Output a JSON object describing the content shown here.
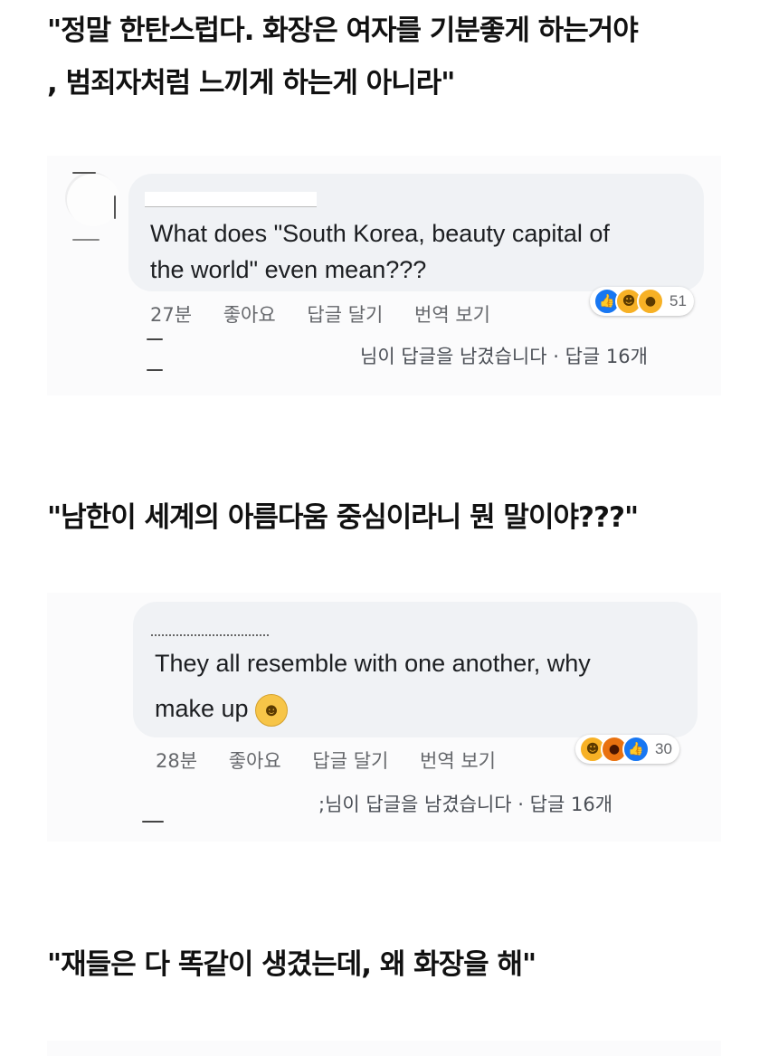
{
  "captions": {
    "c1_line1": "\"정말 한탄스럽다. 화장은 여자를 기분좋게 하는거야",
    "c1_line2": ", 범죄자처럼 느끼게 하는게 아니라\"",
    "c2": "\"남한이 세계의 아름다움 중심이라니 뭔 말이야???\"",
    "c3": "\"재들은 다 똑같이 생겼는데, 왜 화장을 해\""
  },
  "comment1": {
    "text_line1": "What does \"South Korea, beauty capital of",
    "text_line2": "the world\" even mean???",
    "time": "27분",
    "like": "좋아요",
    "reply": "답글 달기",
    "translate": "번역 보기",
    "reaction_icons": [
      "like-icon",
      "haha-icon",
      "wow-icon"
    ],
    "reaction_count": "51",
    "reply_summary": "님이 답글을 남겼습니다 · 답글 16개"
  },
  "comment2": {
    "text_line1": "They all resemble with one another, why",
    "text_line2": "make up",
    "emoji": "grinning-face-icon",
    "time": "28분",
    "like": "좋아요",
    "reply": "답글 달기",
    "translate": "번역 보기",
    "reaction_icons": [
      "haha-icon",
      "angry-icon",
      "like-icon"
    ],
    "reaction_count": "30",
    "reply_summary": ";님이 답글을 남겼습니다 · 답글 16개"
  },
  "colors": {
    "bubble": "#f0f2f5",
    "like": "#1877f2",
    "haha": "#f7b125",
    "angry": "#e9710f",
    "meta": "#65676b"
  }
}
